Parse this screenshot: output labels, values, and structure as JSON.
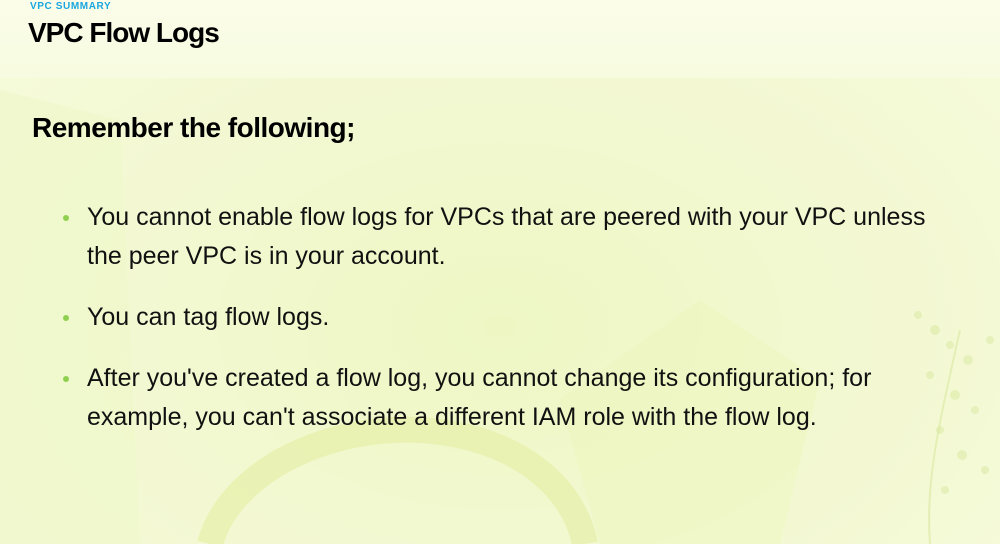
{
  "header": {
    "eyebrow": "VPC SUMMARY",
    "title": "VPC Flow Logs"
  },
  "content": {
    "heading": "Remember the following;",
    "bullets": [
      "You cannot enable flow logs for VPCs that are peered with your VPC unless the peer VPC is in your account.",
      "You can tag flow logs.",
      "After you've created a flow log, you cannot change its configuration; for example, you can't associate a different IAM role with the flow log."
    ]
  },
  "colors": {
    "background": "#f3f9d2",
    "eyebrow": "#1aa6df",
    "bullet": "#8fd14f",
    "text": "#111111"
  }
}
